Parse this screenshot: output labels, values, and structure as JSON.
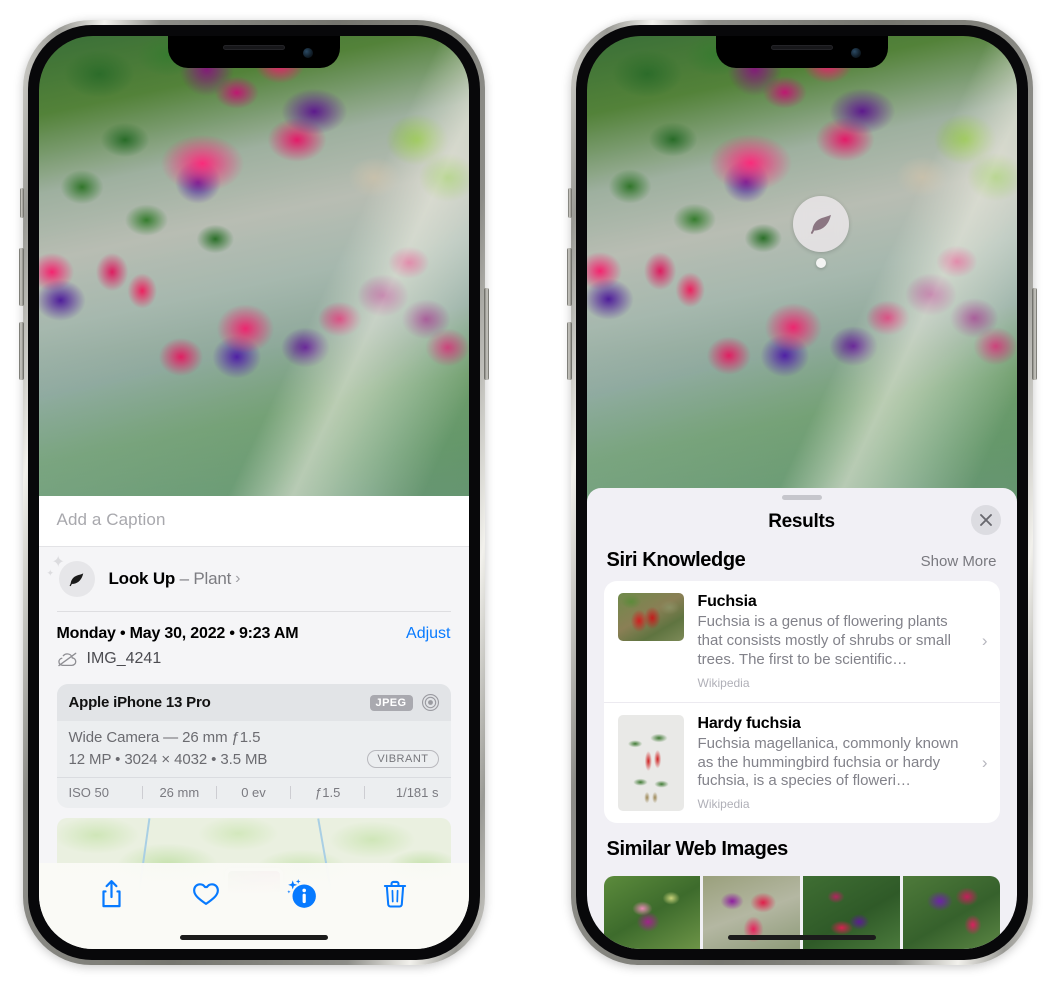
{
  "left_phone": {
    "name": "photos-detail-view",
    "photo": {
      "alt": "fuchsia-flowers-hanging-basket"
    },
    "caption": {
      "placeholder": "Add a Caption",
      "value": ""
    },
    "look_up": {
      "label": "Look Up",
      "dash": "–",
      "subject": "Plant",
      "chevron": "›",
      "icon": "leaf-icon",
      "sparkle": "sparkles-icon"
    },
    "meta": {
      "date": "Monday • May 30, 2022 • 9:23 AM",
      "adjust_label": "Adjust",
      "cloud_icon": "cloud-slash-icon",
      "filename": "IMG_4241"
    },
    "camera_card": {
      "model": "Apple iPhone 13 Pro",
      "format_badge": "JPEG",
      "lens_icon": "aperture-icon",
      "lens_line": "Wide Camera — 26 mm ƒ1.5",
      "specs_line": "12 MP • 3024 × 4032 • 3.5 MB",
      "style_badge": "VIBRANT",
      "exif": [
        {
          "label": "ISO 50"
        },
        {
          "label": "26 mm"
        },
        {
          "label": "0 ev"
        },
        {
          "label": "ƒ1.5"
        },
        {
          "label": "1/181 s"
        }
      ]
    },
    "map": {
      "name": "location-map-strip",
      "pin": "photo-pin"
    },
    "toolbar": [
      {
        "name": "share-button",
        "icon": "share-icon",
        "label": "Share"
      },
      {
        "name": "favorite-button",
        "icon": "heart-icon",
        "label": "Favorite"
      },
      {
        "name": "info-button",
        "icon": "info-sparkle-icon",
        "label": "Info",
        "active": true
      },
      {
        "name": "delete-button",
        "icon": "trash-icon",
        "label": "Delete"
      }
    ]
  },
  "right_phone": {
    "name": "visual-look-up-results",
    "leaf_badge": {
      "icon": "leaf-icon"
    },
    "sheet": {
      "grabber": "drag-handle",
      "title": "Results",
      "close_icon": "close-icon"
    },
    "siri_knowledge": {
      "title": "Siri Knowledge",
      "action": "Show More",
      "items": [
        {
          "title": "Fuchsia",
          "description": "Fuchsia is a genus of flowering plants that consists mostly of shrubs or small trees. The first to be scientific…",
          "source": "Wikipedia",
          "thumb": "fuchsia-red-flowers-thumb",
          "chevron": "›"
        },
        {
          "title": "Hardy fuchsia",
          "description": "Fuchsia magellanica, commonly known as the hummingbird fuchsia or hardy fuchsia, is a species of floweri…",
          "source": "Wikipedia",
          "thumb": "hardy-fuchsia-branch-thumb",
          "chevron": "›"
        }
      ]
    },
    "similar_web_images": {
      "title": "Similar Web Images",
      "items": [
        {
          "name": "web-image-1",
          "alt": "pink-purple-fuchsia-on-green-leaves"
        },
        {
          "name": "web-image-2",
          "alt": "red-magenta-fuchsia-closeup"
        },
        {
          "name": "web-image-3",
          "alt": "fuchsia-bush-with-buds"
        },
        {
          "name": "web-image-4",
          "alt": "purple-red-double-fuchsia"
        }
      ]
    }
  },
  "colors": {
    "accent_blue": "#077aff",
    "sheet_gray": "#f1f0f5",
    "card_white": "#ffffff",
    "secondary_text": "#82828a"
  }
}
